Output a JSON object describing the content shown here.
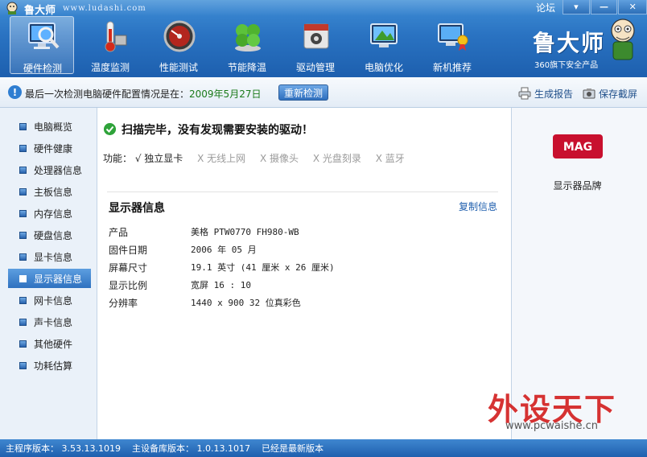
{
  "window": {
    "title": "鲁大师",
    "url": "www.ludashi.com",
    "forum_label": "论坛",
    "min_label": "—",
    "max_label": "▾",
    "close_label": "✕"
  },
  "nav": {
    "items": [
      {
        "label": "硬件检测",
        "icon": "hardware-scan-icon",
        "active": true
      },
      {
        "label": "温度监测",
        "icon": "thermometer-icon"
      },
      {
        "label": "性能测试",
        "icon": "speedometer-icon"
      },
      {
        "label": "节能降温",
        "icon": "clover-icon"
      },
      {
        "label": "驱动管理",
        "icon": "driver-box-icon"
      },
      {
        "label": "电脑优化",
        "icon": "monitor-broom-icon"
      },
      {
        "label": "新机推荐",
        "icon": "monitor-award-icon"
      }
    ]
  },
  "brand": {
    "name": "鲁大师",
    "subtitle": "360旗下安全产品"
  },
  "infobar": {
    "prefix": "最后一次检测电脑硬件配置情况是在：",
    "date": "2009年5月27日",
    "rescan_label": "重新检测",
    "report_label": "生成报告",
    "screenshot_label": "保存截屏"
  },
  "sidebar": {
    "items": [
      {
        "label": "电脑概览"
      },
      {
        "label": "硬件健康"
      },
      {
        "label": "处理器信息"
      },
      {
        "label": "主板信息"
      },
      {
        "label": "内存信息"
      },
      {
        "label": "硬盘信息"
      },
      {
        "label": "显卡信息"
      },
      {
        "label": "显示器信息",
        "active": true
      },
      {
        "label": "网卡信息"
      },
      {
        "label": "声卡信息"
      },
      {
        "label": "其他硬件"
      },
      {
        "label": "功耗估算"
      }
    ]
  },
  "main": {
    "scan_result": "扫描完毕，没有发现需要安装的驱动！",
    "features_label": "功能：",
    "features": [
      {
        "text": "√ 独立显卡",
        "enabled": true
      },
      {
        "text": "X 无线上网",
        "enabled": false
      },
      {
        "text": "X 摄像头",
        "enabled": false
      },
      {
        "text": "X 光盘刻录",
        "enabled": false
      },
      {
        "text": "X 蓝牙",
        "enabled": false
      }
    ],
    "section_title": "显示器信息",
    "copy_label": "复制信息",
    "rows": [
      {
        "key": "产品",
        "value": "美格 PTW0770 FH980-WB"
      },
      {
        "key": "固件日期",
        "value": "2006 年 05 月"
      },
      {
        "key": "屏幕尺寸",
        "value": "19.1 英寸 (41 厘米 x 26 厘米)"
      },
      {
        "key": "显示比例",
        "value": "宽屏 16 : 10"
      },
      {
        "key": "分辨率",
        "value": "1440 x 900 32 位真彩色"
      }
    ]
  },
  "rightpanel": {
    "logo_text": "MAG",
    "caption": "显示器品牌"
  },
  "watermark": {
    "text": "外设天下",
    "url": "www.pcwaishe.cn"
  },
  "statusbar": {
    "main_version": "主程序版本： 3.53.13.1019",
    "db_version": "主设备库版本： 1.0.13.1017",
    "latest": "已经是最新版本"
  },
  "colors": {
    "accent": "#2a73c2",
    "enabled_date": "#1a7a1a",
    "logo_red": "#c8102e"
  }
}
